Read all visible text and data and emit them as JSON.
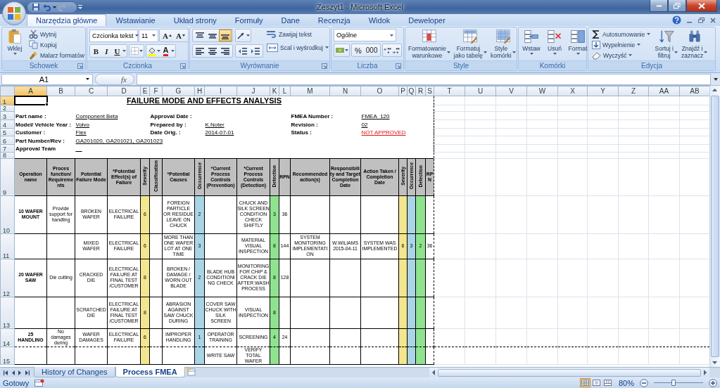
{
  "window": {
    "title": "Zeszyt1 - Microsoft Excel"
  },
  "tabs": [
    {
      "label": "Narzędzia główne",
      "selected": true
    },
    {
      "label": "Wstawianie",
      "selected": false
    },
    {
      "label": "Układ strony",
      "selected": false
    },
    {
      "label": "Formuły",
      "selected": false
    },
    {
      "label": "Dane",
      "selected": false
    },
    {
      "label": "Recenzja",
      "selected": false
    },
    {
      "label": "Widok",
      "selected": false
    },
    {
      "label": "Deweloper",
      "selected": false
    }
  ],
  "ribbon": {
    "clipboard": {
      "title": "Schowek",
      "paste": "Wklej",
      "items": [
        "Wytnij",
        "Kopiuj",
        "Malarz formatów"
      ]
    },
    "font": {
      "title": "Czcionka",
      "font_name": "Czcionka tekst",
      "font_size": "11",
      "grow": "A",
      "shrink": "A",
      "bold": "B",
      "italic": "I",
      "underline": "U",
      "color_letter": "A"
    },
    "alignment": {
      "title": "Wyrównanie",
      "vertical": [
        {
          "selected": false
        },
        {
          "selected": false
        },
        {
          "selected": true
        }
      ],
      "wrap": "Zawijaj tekst",
      "merge": "Scal i wyśrodkuj"
    },
    "number": {
      "title": "Liczba",
      "format": "Ogólne",
      "percent": "%",
      "thousands": "000"
    },
    "styles": {
      "title": "Style",
      "items": [
        "Formatowanie\nwarunkowe",
        "Formatuj\njako tabelę",
        "Style\nkomórki"
      ]
    },
    "cells": {
      "title": "Komórki",
      "items": [
        "Wstaw",
        "Usuń",
        "Format"
      ]
    },
    "editing": {
      "title": "Edycja",
      "small": [
        "Autosumowanie",
        "Wypełnienie",
        "Wyczyść"
      ],
      "large": [
        "Sortuj i\nfiltruj",
        "Znajdź i\nzaznacz"
      ]
    }
  },
  "formula_bar": {
    "name_box": "A1",
    "fx": "fx"
  },
  "sheet": {
    "columns": [
      {
        "label": "A",
        "selected": true
      },
      {
        "label": "B",
        "selected": false
      },
      {
        "label": "C",
        "selected": false
      },
      {
        "label": "D",
        "selected": false
      },
      {
        "label": "E",
        "selected": false
      },
      {
        "label": "F",
        "selected": false
      },
      {
        "label": "G",
        "selected": false
      },
      {
        "label": "H",
        "selected": false
      },
      {
        "label": "I",
        "selected": false
      },
      {
        "label": "J",
        "selected": false
      },
      {
        "label": "K",
        "selected": false
      },
      {
        "label": "L",
        "selected": false
      },
      {
        "label": "M",
        "selected": false
      },
      {
        "label": "N",
        "selected": false
      },
      {
        "label": "O",
        "selected": false
      },
      {
        "label": "P",
        "selected": false
      },
      {
        "label": "Q",
        "selected": false
      },
      {
        "label": "R",
        "selected": false
      },
      {
        "label": "S",
        "selected": false
      },
      {
        "label": "T",
        "selected": false
      },
      {
        "label": "U",
        "selected": false
      },
      {
        "label": "V",
        "selected": false
      },
      {
        "label": "W",
        "selected": false
      },
      {
        "label": "X",
        "selected": false
      },
      {
        "label": "Y",
        "selected": false
      },
      {
        "label": "Z",
        "selected": false
      },
      {
        "label": "AA",
        "selected": false
      },
      {
        "label": "AB",
        "selected": false
      }
    ],
    "rows": [
      {
        "label": "1",
        "selected": true
      },
      {
        "label": "2",
        "selected": false
      },
      {
        "label": "3",
        "selected": false
      },
      {
        "label": "4",
        "selected": false
      },
      {
        "label": "5",
        "selected": false
      },
      {
        "label": "6",
        "selected": false
      },
      {
        "label": "7",
        "selected": false
      },
      {
        "label": "8",
        "selected": false
      },
      {
        "label": "9",
        "selected": false
      },
      {
        "label": "10",
        "selected": false
      },
      {
        "label": "11",
        "selected": false
      },
      {
        "label": "12",
        "selected": false
      },
      {
        "label": "13",
        "selected": false
      },
      {
        "label": "14",
        "selected": false
      },
      {
        "label": "15",
        "selected": false
      }
    ],
    "title": "FAILURE MODE AND EFFECTS ANALYSIS",
    "info_rows": [
      {
        "left": {
          "label": "Part name :",
          "value": "Component Beta"
        },
        "middle": {
          "label": "Approval Date :"
        },
        "right": {
          "label": "FMEA Number :",
          "value": "FMEA_120"
        }
      },
      {
        "left": {
          "label": "Model/ Vehicle Year :",
          "value": "Volvo"
        },
        "middle": {
          "label": "Prepared by :",
          "value": "K.Noter"
        },
        "right": {
          "label": "Revision :",
          "value": "02"
        }
      },
      {
        "left": {
          "label": "Customer :",
          "value": "Flex"
        },
        "middle": {
          "label": "Date Orig. :",
          "value": "2014-07-01"
        },
        "right": {
          "label": "Status :",
          "value": "NOT APPROVED",
          "alert": true
        }
      },
      {
        "left": {
          "label": "Part Number/Rev :",
          "value": "GA201020, GA201021, GA201023"
        }
      },
      {
        "left": {
          "label": "Approval Team",
          "value": "__"
        }
      }
    ],
    "table": {
      "columns": [
        {
          "label": "Operation name",
          "vertical": false
        },
        {
          "label": "Proces function/ Requirements",
          "vertical": false
        },
        {
          "label": "Potential Failure Mode",
          "vertical": false
        },
        {
          "label": "*Potential Effect(s) of Failure",
          "vertical": false
        },
        {
          "label": "Severity",
          "vertical": true,
          "color": "#f3e68e"
        },
        {
          "label": "Classification",
          "vertical": true
        },
        {
          "label": "*Potential Causes",
          "vertical": false
        },
        {
          "label": "Occurrence",
          "vertical": true,
          "color": "#a9d5e6"
        },
        {
          "label": "*Current Process Controls (Prevention)",
          "vertical": false
        },
        {
          "label": "*Current Process Controls (Detection)",
          "vertical": false
        },
        {
          "label": "Detection",
          "vertical": true,
          "color": "#8fe38f"
        },
        {
          "label": "RPN",
          "vertical": false
        },
        {
          "label": "Recommended action(s)",
          "vertical": false
        },
        {
          "label": "Responsibility and Target Completion Date",
          "vertical": false
        },
        {
          "label": "Action Taken / Completion Date",
          "vertical": false
        },
        {
          "label": "Severity",
          "vertical": true,
          "color": "#f3e68e"
        },
        {
          "label": "Occurrence",
          "vertical": true,
          "color": "#a9d5e6"
        },
        {
          "label": "Detection",
          "vertical": true,
          "color": "#8fe38f"
        },
        {
          "label": "RPN",
          "vertical": false
        }
      ],
      "rows": [
        {
          "cells": [
            "10 WAFER MOUNT",
            "Provide support for handling",
            "BROKEN WAFER",
            "ELECTRICAL FAILURE",
            "6",
            null,
            "FOREIGN PARTICLE OR RESIDUE LEAVE ON CHUCK",
            "2",
            null,
            "CHUCK AND SILK SCREEN CONDITION CHECK SHIFTLY",
            "3",
            "36",
            null,
            null,
            null,
            null,
            null,
            null,
            null
          ]
        },
        {
          "cells": [
            null,
            null,
            "MIXED WAFER",
            "ELECTRICAL FAILURE",
            "6",
            null,
            "MORE THAN ONE WAFER LOT AT ONE TIME",
            "3",
            null,
            "MATERIAL VISUAL INSPECTION",
            "8",
            "144",
            "SYSTEM MONITORING IMPLEMENTATION",
            "W.WILIAMS 2015-04-11",
            "SYSTEM WAS IMPLEMENTED",
            "6",
            "3",
            "2",
            "36"
          ]
        },
        {
          "cells": [
            "20 WAFER SAW",
            "Die cutting",
            "CRACKED DIE",
            "ELECTRICAL FAILURE AT FINAL TEST /CUSTOMER",
            "8",
            null,
            "BROKEN / DAMAGE / WORN OUT BLADE",
            "2",
            "BLADE HUB CONDITIONING CHECK",
            "MONITORING FOR CHIP & CRACK DIE AFTER WASH PROCESS",
            "8",
            "128",
            null,
            null,
            null,
            null,
            null,
            null,
            null
          ]
        },
        {
          "cells": [
            null,
            null,
            "SCRATCHED DIE",
            "ELECTRICAL FAILURE AT FINAL TEST /CUSTOMER",
            "8",
            null,
            "ABRASION AGAINST SAW CHUCK DURING",
            null,
            "COVER SAW CHUCK WITH SILK SCREEN",
            "VISUAL INSPECTION",
            "8",
            null,
            null,
            null,
            null,
            null,
            null,
            null,
            null
          ]
        },
        {
          "cells": [
            "25 HANDLING",
            "No damages during",
            "WAFER DAMAGES",
            "ELECTRICAL FAILURE",
            "6",
            null,
            "IMPROPER HANDLING",
            "1",
            "OPERATOR TRAINING",
            "SCREENING",
            "4",
            "24",
            null,
            null,
            null,
            null,
            null,
            null,
            null
          ]
        },
        {
          "cells": [
            null,
            null,
            null,
            null,
            null,
            null,
            null,
            null,
            "WRITE SAW",
            "VERIFY TOTAL WAFER",
            null,
            null,
            null,
            null,
            null,
            null,
            null,
            null,
            null
          ]
        }
      ]
    }
  },
  "sheet_tabs": [
    {
      "label": "History of Changes",
      "selected": false
    },
    {
      "label": "Process FMEA",
      "selected": true
    }
  ],
  "status_bar": {
    "text": "Gotowy",
    "views": [
      {
        "selected": true
      },
      {
        "selected": false
      },
      {
        "selected": false
      }
    ],
    "zoom": {
      "label": "80%",
      "level": 0.4
    }
  }
}
